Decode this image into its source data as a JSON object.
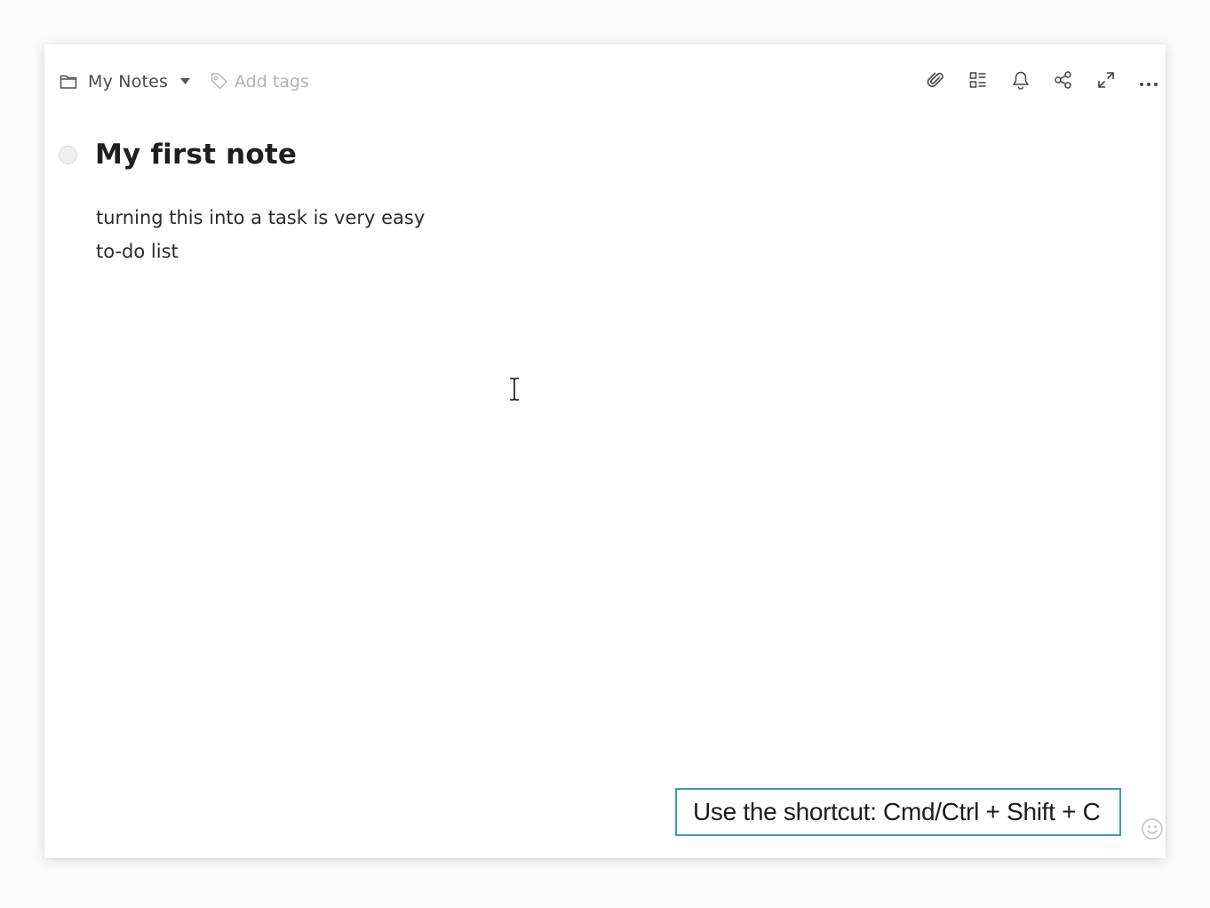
{
  "toolbar": {
    "notebook": {
      "icon": "folder-icon",
      "label": "My Notes",
      "dropdown_icon": "caret-down-icon"
    },
    "tags": {
      "icon": "tag-icon",
      "placeholder": "Add tags"
    },
    "actions": [
      {
        "name": "attachment",
        "icon": "paperclip-icon"
      },
      {
        "name": "checklist",
        "icon": "checklist-icon"
      },
      {
        "name": "reminder",
        "icon": "bell-icon"
      },
      {
        "name": "share",
        "icon": "share-icon"
      },
      {
        "name": "expand",
        "icon": "expand-icon"
      },
      {
        "name": "more",
        "icon": "more-icon"
      }
    ]
  },
  "note": {
    "title": "My first note",
    "task_checkbox_icon": "task-circle-icon",
    "lines": [
      "turning this into a task is very easy",
      "to-do list"
    ]
  },
  "hint": {
    "text": "Use the shortcut: Cmd/Ctrl + Shift + C",
    "border_color": "#3d9ab8"
  },
  "footer": {
    "emoji_icon": "smiley-icon"
  }
}
